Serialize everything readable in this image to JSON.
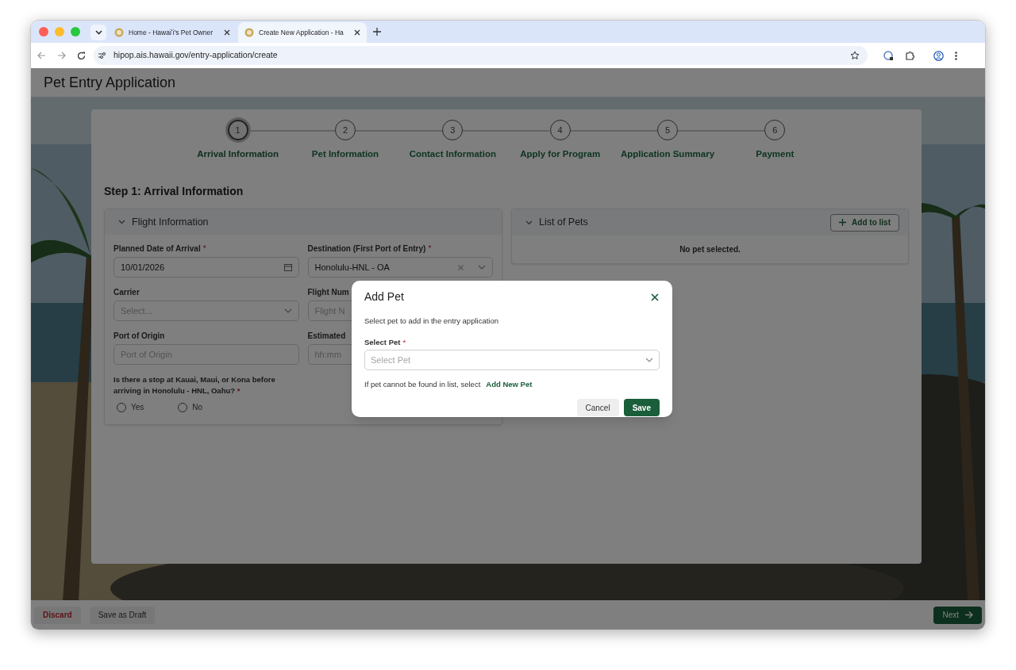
{
  "browser": {
    "tabs": [
      {
        "title": "Home - Hawaiʻi's Pet Owner",
        "selected": false
      },
      {
        "title": "Create New Application - Ha",
        "selected": true
      }
    ],
    "url": "hipop.ais.hawaii.gov/entry-application/create"
  },
  "page_title": "Pet Entry Application",
  "stepper": [
    {
      "number": "1",
      "label": "Arrival Information",
      "selected": true
    },
    {
      "number": "2",
      "label": "Pet Information",
      "selected": false
    },
    {
      "number": "3",
      "label": "Contact Information",
      "selected": false
    },
    {
      "number": "4",
      "label": "Apply for Program",
      "selected": false
    },
    {
      "number": "5",
      "label": "Application Summary",
      "selected": false
    },
    {
      "number": "6",
      "label": "Payment",
      "selected": false
    }
  ],
  "step_heading": "Step 1: Arrival Information",
  "flight_section": {
    "title": "Flight Information",
    "expanded": true,
    "fields": [
      {
        "kind": "date",
        "label": "Planned Date of Arrival",
        "required_mark": "*",
        "value": "10/01/2026"
      },
      {
        "kind": "select",
        "label": "Destination (First Port of Entry)",
        "required_mark": "*",
        "value": "Honolulu-HNL - OA",
        "clearable": true
      },
      {
        "kind": "select",
        "label": "Carrier",
        "placeholder": "Select..."
      },
      {
        "kind": "text",
        "label": "Flight Num",
        "placeholder": "Flight N"
      },
      {
        "kind": "text",
        "label": "Port of Origin",
        "placeholder": "Port of Origin"
      },
      {
        "kind": "text",
        "label": "Estimated",
        "placeholder": "hh:mm"
      }
    ],
    "question": {
      "label": "Is there a stop at Kauai, Maui, or Kona before arriving in Honolulu - HNL, Oahu?",
      "required_mark": "*",
      "options": [
        {
          "label": "Yes",
          "selected": false
        },
        {
          "label": "No",
          "selected": false
        }
      ]
    }
  },
  "pets_section": {
    "title": "List of Pets",
    "expanded": true,
    "add_button": "Add to list",
    "empty_text": "No pet selected."
  },
  "footer": {
    "discard": "Discard",
    "save_draft": "Save as Draft",
    "next": "Next"
  },
  "modal": {
    "title": "Add Pet",
    "description": "Select pet to add in the entry application",
    "field_label": "Select Pet",
    "required_mark": "*",
    "placeholder": "Select Pet",
    "hint": "If pet cannot be found in list, select",
    "link": "Add New Pet",
    "cancel": "Cancel",
    "save": "Save"
  }
}
